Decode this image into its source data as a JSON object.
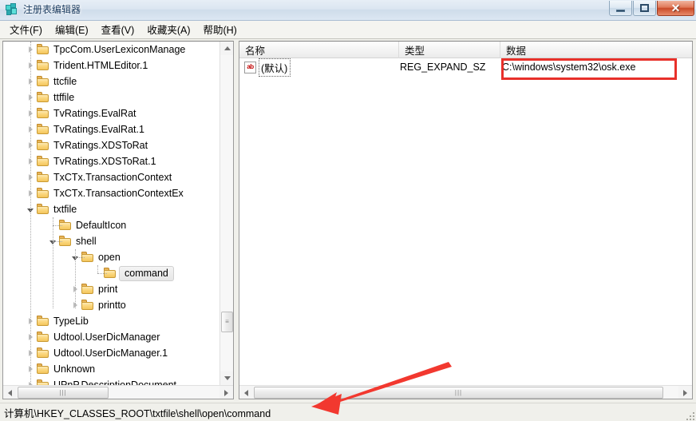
{
  "window": {
    "title": "注册表编辑器",
    "app_icon": "registry-editor-icon",
    "buttons": {
      "minimize": "最小化",
      "maximize": "最大化",
      "close": "关闭"
    }
  },
  "menu": {
    "items": [
      {
        "label": "文件(F)"
      },
      {
        "label": "编辑(E)"
      },
      {
        "label": "查看(V)"
      },
      {
        "label": "收藏夹(A)"
      },
      {
        "label": "帮助(H)"
      }
    ]
  },
  "tree": {
    "nodes": [
      {
        "label": "TpcCom.UserLexiconManage",
        "indent": 1,
        "state": "collapsed"
      },
      {
        "label": "Trident.HTMLEditor.1",
        "indent": 1,
        "state": "collapsed"
      },
      {
        "label": "ttcfile",
        "indent": 1,
        "state": "collapsed"
      },
      {
        "label": "ttffile",
        "indent": 1,
        "state": "collapsed"
      },
      {
        "label": "TvRatings.EvalRat",
        "indent": 1,
        "state": "collapsed"
      },
      {
        "label": "TvRatings.EvalRat.1",
        "indent": 1,
        "state": "collapsed"
      },
      {
        "label": "TvRatings.XDSToRat",
        "indent": 1,
        "state": "collapsed"
      },
      {
        "label": "TvRatings.XDSToRat.1",
        "indent": 1,
        "state": "collapsed"
      },
      {
        "label": "TxCTx.TransactionContext",
        "indent": 1,
        "state": "collapsed"
      },
      {
        "label": "TxCTx.TransactionContextEx",
        "indent": 1,
        "state": "collapsed"
      },
      {
        "label": "txtfile",
        "indent": 1,
        "state": "expanded"
      },
      {
        "label": "DefaultIcon",
        "indent": 2,
        "state": "leaf"
      },
      {
        "label": "shell",
        "indent": 2,
        "state": "expanded"
      },
      {
        "label": "open",
        "indent": 3,
        "state": "expanded"
      },
      {
        "label": "command",
        "indent": 4,
        "state": "leaf",
        "selected": true
      },
      {
        "label": "print",
        "indent": 3,
        "state": "collapsed"
      },
      {
        "label": "printto",
        "indent": 3,
        "state": "collapsed"
      },
      {
        "label": "TypeLib",
        "indent": 1,
        "state": "collapsed"
      },
      {
        "label": "Udtool.UserDicManager",
        "indent": 1,
        "state": "collapsed"
      },
      {
        "label": "Udtool.UserDicManager.1",
        "indent": 1,
        "state": "collapsed"
      },
      {
        "label": "Unknown",
        "indent": 1,
        "state": "collapsed"
      },
      {
        "label": "UPnP.DescriptionDocument",
        "indent": 1,
        "state": "collapsed"
      }
    ]
  },
  "list": {
    "columns": [
      {
        "label": "名称"
      },
      {
        "label": "类型"
      },
      {
        "label": "数据"
      }
    ],
    "rows": [
      {
        "name": "(默认)",
        "icon": "string-value-icon",
        "type": "REG_EXPAND_SZ",
        "data": "C:\\windows\\system32\\osk.exe",
        "highlighted": true
      }
    ]
  },
  "status": {
    "path": "计算机\\HKEY_CLASSES_ROOT\\txtfile\\shell\\open\\command"
  },
  "annotations": {
    "highlight_color": "#e8302a",
    "arrow_color": "#f2382f"
  }
}
